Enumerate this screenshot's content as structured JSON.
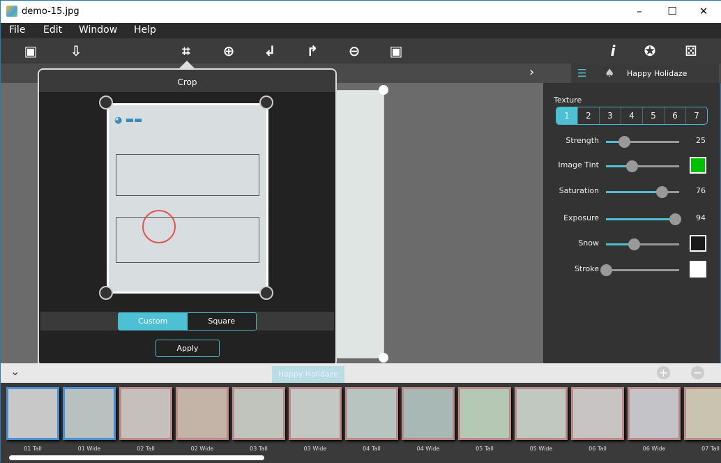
{
  "window": {
    "title": "demo-15.jpg",
    "minimize": "–",
    "maximize": "☐",
    "close": "✕"
  },
  "menu": [
    "File",
    "Edit",
    "Window",
    "Help"
  ],
  "toolbar": {
    "icons": [
      "open-image-icon",
      "save-icon",
      "crop-icon",
      "zoom-in-icon",
      "rotate-left-icon",
      "rotate-right-icon",
      "zoom-out-icon",
      "fit-image-icon",
      "info-icon",
      "settings-icon",
      "random-icon"
    ],
    "glyphs": {
      "open": "▣",
      "save": "⇩",
      "crop": "⌗",
      "zoomin": "⊕",
      "rotl": "↲",
      "rotr": "↱",
      "zoomout": "⊖",
      "fit": "▣",
      "info": "i",
      "settings": "✪",
      "random": "⚄"
    }
  },
  "subbar": {
    "next": "›"
  },
  "right_panel": {
    "header": {
      "list_icon": "☰",
      "tree_icon": "♠",
      "title": "Happy Holidaze"
    },
    "texture_label": "Texture",
    "textures": [
      "1",
      "2",
      "3",
      "4",
      "5",
      "6",
      "7"
    ],
    "texture_selected": "1",
    "controls": [
      {
        "label": "Strength",
        "value": 25,
        "display": "25"
      },
      {
        "label": "Image Tint",
        "value": 35,
        "swatch": "#00c000"
      },
      {
        "label": "Saturation",
        "value": 76,
        "display": "76"
      },
      {
        "label": "Exposure",
        "value": 94,
        "display": "94"
      },
      {
        "label": "Snow",
        "value": 38,
        "swatch": "#1a1a1a"
      },
      {
        "label": "Stroke",
        "value": 0,
        "swatch": "#ffffff"
      }
    ]
  },
  "crop": {
    "title": "Crop",
    "modes": [
      "Custom",
      "Square"
    ],
    "selected_mode": "Custom",
    "apply": "Apply"
  },
  "bottom": {
    "collapse": "⌄",
    "category": "Happy Holidaze",
    "add": "+",
    "remove": "−"
  },
  "thumbnails": [
    "01 Tall",
    "01 Wide",
    "02 Tall",
    "02 Wide",
    "03 Tall",
    "03 Wide",
    "04 Tall",
    "04 Wide",
    "05 Tall",
    "05 Wide",
    "06 Tall",
    "06 Wide",
    "07 Tall"
  ],
  "colors": {
    "accent": "#4ec0d4",
    "panel": "#333333"
  }
}
